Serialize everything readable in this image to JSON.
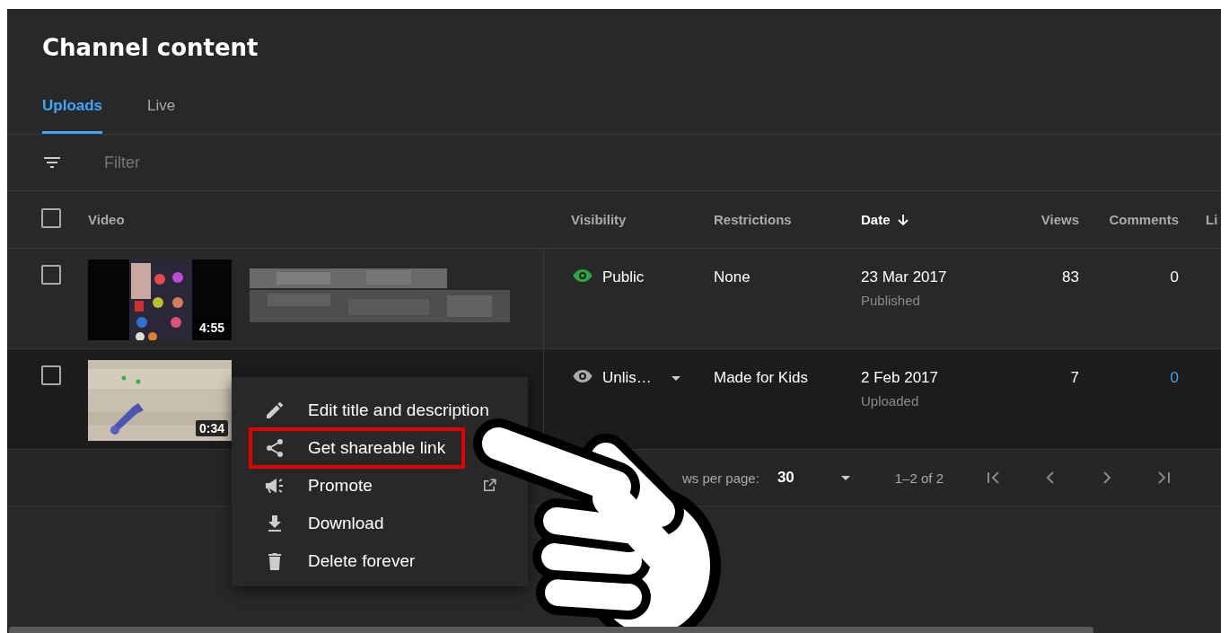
{
  "page": {
    "title": "Channel content"
  },
  "tabs": [
    {
      "label": "Uploads",
      "selected": true
    },
    {
      "label": "Live",
      "selected": false
    }
  ],
  "filter": {
    "placeholder": "Filter"
  },
  "table": {
    "header_checkbox": {
      "checked": false
    },
    "columns": [
      {
        "label": "Video",
        "sorted": false
      },
      {
        "label": "Visibility",
        "sorted": false
      },
      {
        "label": "Restrictions",
        "sorted": false
      },
      {
        "label": "Date",
        "sorted": true
      },
      {
        "label": "Views",
        "sorted": false
      },
      {
        "label": "Comments",
        "sorted": false
      },
      {
        "label": "Li",
        "sorted": false
      }
    ],
    "rows": [
      {
        "checked": false,
        "highlighted": false,
        "duration": "4:55",
        "title": {
          "kind": "redacted"
        },
        "color": "#2ba640",
        "visibility": "Public",
        "visibility_dropdown": false,
        "restrictions": "None",
        "date": "23 Mar 2017",
        "date_status": "Published",
        "views": "83",
        "comments": "0",
        "comments_link": false
      },
      {
        "checked": false,
        "highlighted": true,
        "duration": "0:34",
        "color": "#aaaaaa",
        "visibility": "Unlis…",
        "visibility_dropdown": true,
        "restrictions": "Made for Kids",
        "date": "2 Feb 2017",
        "date_status": "Uploaded",
        "views": "7",
        "comments": "0",
        "comments_link": true
      }
    ]
  },
  "pagination": {
    "rows_label": "ws per page:",
    "rows_value": "30",
    "range": "1–2 of 2"
  },
  "menu": {
    "items": [
      {
        "kind": "edit",
        "label": "Edit title and description",
        "highlighted": false,
        "external": false
      },
      {
        "kind": "share",
        "label": "Get shareable link",
        "highlighted": true,
        "external": false
      },
      {
        "kind": "promote",
        "label": "Promote",
        "highlighted": false,
        "external": true
      },
      {
        "kind": "download",
        "label": "Download",
        "highlighted": false,
        "external": false
      },
      {
        "kind": "delete",
        "label": "Delete forever",
        "highlighted": false,
        "external": false
      }
    ]
  }
}
